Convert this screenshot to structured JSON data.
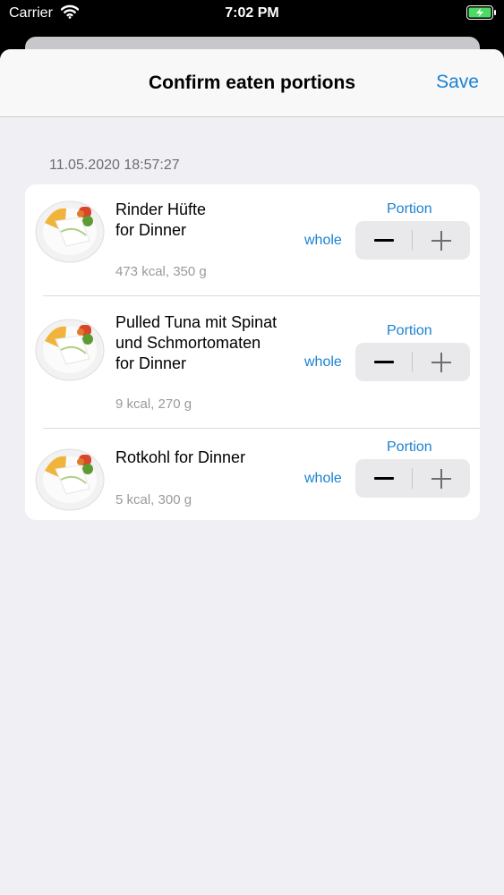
{
  "status_bar": {
    "carrier": "Carrier",
    "time": "7:02 PM",
    "battery_color": "#4cd964"
  },
  "nav": {
    "title": "Confirm eaten portions",
    "save_label": "Save"
  },
  "section": {
    "date": "11.05.2020 18:57:27"
  },
  "items": [
    {
      "title_line1": "Rinder Hüfte",
      "title_line2": "for Dinner",
      "title_line3": "",
      "meta": "473 kcal, 350 g",
      "portion_label": "Portion",
      "amount": "whole"
    },
    {
      "title_line1": "Pulled Tuna mit Spinat",
      "title_line2": "und Schmortomaten",
      "title_line3": "for Dinner",
      "meta": "9 kcal, 270 g",
      "portion_label": "Portion",
      "amount": "whole"
    },
    {
      "title_line1": "Rotkohl for Dinner",
      "title_line2": "",
      "title_line3": "",
      "meta": "5 kcal, 300 g",
      "portion_label": "Portion",
      "amount": "whole"
    }
  ],
  "colors": {
    "accent": "#1a82d2",
    "background": "#efeff4"
  },
  "icons": {
    "wifi": "wifi-icon",
    "battery": "battery-charging-icon",
    "minus": "minus-icon",
    "plus": "plus-icon",
    "food": "food-plate-image"
  }
}
